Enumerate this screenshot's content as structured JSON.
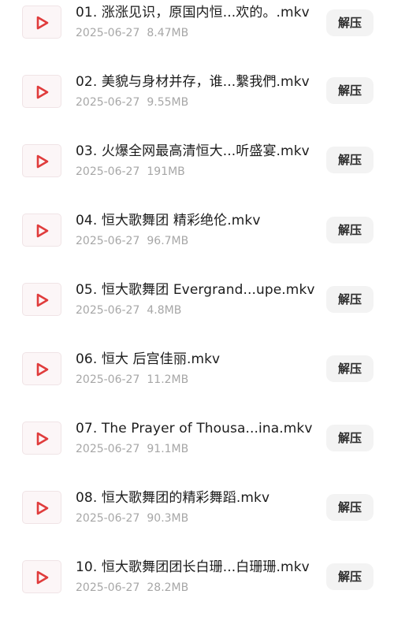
{
  "files": [
    {
      "name": "01. 涨涨见识，原国内恒...欢的。.mkv",
      "date": "2025-06-27",
      "size": "8.47MB",
      "action": "解压"
    },
    {
      "name": "02. 美貌与身材并存，谁...繫我們.mkv",
      "date": "2025-06-27",
      "size": "9.55MB",
      "action": "解压"
    },
    {
      "name": "03. 火爆全网最高清恒大...听盛宴.mkv",
      "date": "2025-06-27",
      "size": "191MB",
      "action": "解压"
    },
    {
      "name": "04. 恒大歌舞团 精彩绝伦.mkv",
      "date": "2025-06-27",
      "size": "96.7MB",
      "action": "解压"
    },
    {
      "name": "05. 恒大歌舞团 Evergrand...upe.mkv",
      "date": "2025-06-27",
      "size": "4.8MB",
      "action": "解压"
    },
    {
      "name": "06. 恒大 后宫佳丽.mkv",
      "date": "2025-06-27",
      "size": "11.2MB",
      "action": "解压"
    },
    {
      "name": "07. The Prayer of Thousa...ina.mkv",
      "date": "2025-06-27",
      "size": "91.1MB",
      "action": "解压"
    },
    {
      "name": "08. 恒大歌舞团的精彩舞蹈.mkv",
      "date": "2025-06-27",
      "size": "90.3MB",
      "action": "解压"
    },
    {
      "name": "10. 恒大歌舞团团长白珊...白珊珊.mkv",
      "date": "2025-06-27",
      "size": "28.2MB",
      "action": "解压"
    }
  ],
  "icons": {
    "file_type": "video-play-icon"
  },
  "colors": {
    "video_icon": "#e03c3c",
    "thumb_bg": "#fcf6f7",
    "button_bg": "#f3f3f3",
    "meta_text": "#a7a7a7"
  }
}
